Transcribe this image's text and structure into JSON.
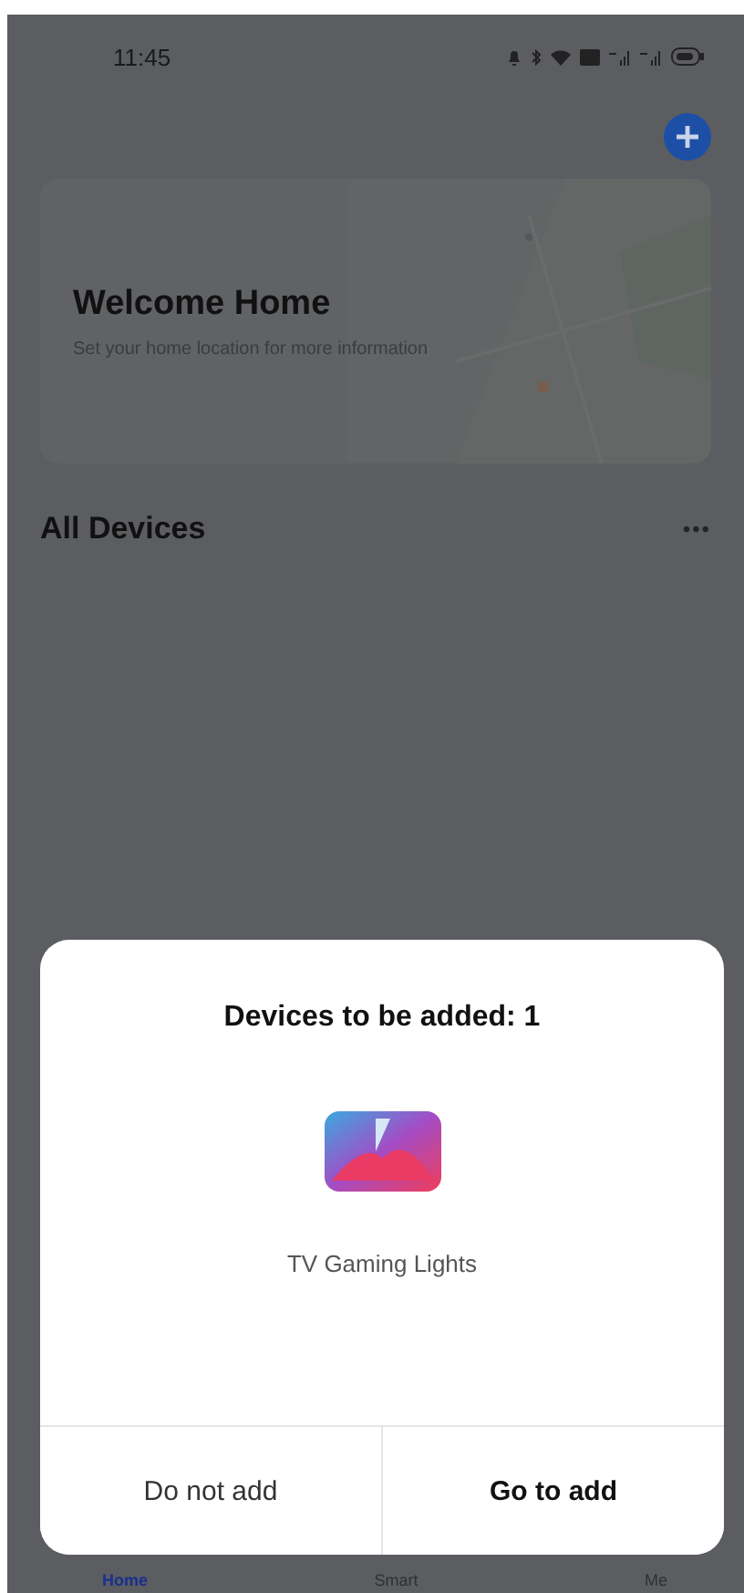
{
  "status_bar": {
    "time": "11:45"
  },
  "home_card": {
    "title": "Welcome Home",
    "subtitle": "Set your home location for more information"
  },
  "section": {
    "title": "All Devices",
    "more": "•••"
  },
  "dialog": {
    "title": "Devices to be added: 1",
    "device": {
      "name": "TV Gaming Lights"
    },
    "buttons": [
      {
        "label": "Do not add",
        "kind": "secondary"
      },
      {
        "label": "Go to add",
        "kind": "primary"
      }
    ]
  },
  "bottom_nav": [
    {
      "label": "Home",
      "selected": true
    },
    {
      "label": "Smart",
      "selected": false
    },
    {
      "label": "Me",
      "selected": false
    }
  ]
}
